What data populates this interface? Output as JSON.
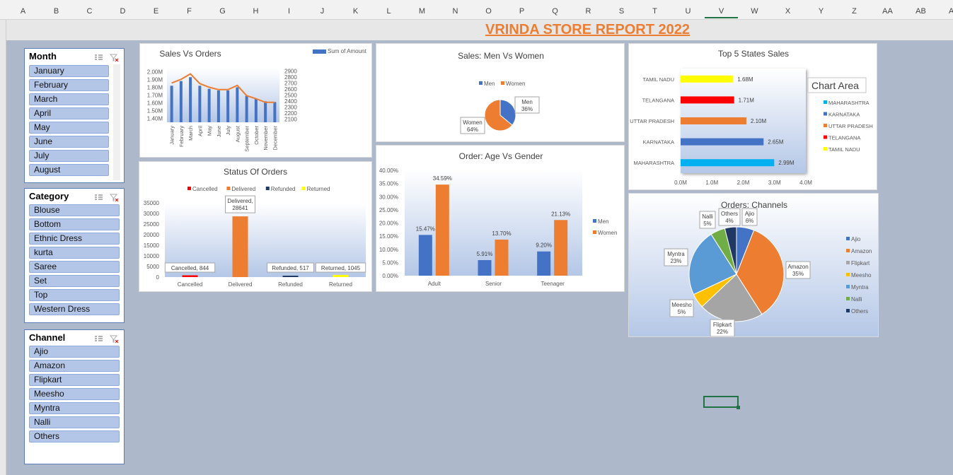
{
  "sheet": {
    "columns": [
      "A",
      "B",
      "C",
      "D",
      "E",
      "F",
      "G",
      "H",
      "I",
      "J",
      "K",
      "L",
      "M",
      "N",
      "O",
      "P",
      "Q",
      "R",
      "S",
      "T",
      "U",
      "V",
      "W",
      "X",
      "Y",
      "Z",
      "AA",
      "AB",
      "AC"
    ],
    "title": "VRINDA STORE REPORT 2022"
  },
  "slicers": {
    "month": {
      "header": "Month",
      "items": [
        "January",
        "February",
        "March",
        "April",
        "May",
        "June",
        "July",
        "August"
      ]
    },
    "category": {
      "header": "Category",
      "items": [
        "Blouse",
        "Bottom",
        "Ethnic Dress",
        "kurta",
        "Saree",
        "Set",
        "Top",
        "Western Dress"
      ]
    },
    "channel": {
      "header": "Channel",
      "items": [
        "Ajio",
        "Amazon",
        "Flipkart",
        "Meesho",
        "Myntra",
        "Nalli",
        "Others"
      ]
    }
  },
  "chart_data": [
    {
      "id": "sales_vs_orders",
      "type": "bar",
      "title": "Sales Vs Orders",
      "legend": [
        "Sum of Amount"
      ],
      "legend_position": "top-right",
      "categories": [
        "January",
        "February",
        "March",
        "April",
        "May",
        "June",
        "July",
        "August",
        "September",
        "October",
        "November",
        "December"
      ],
      "series": [
        {
          "name": "Sum of Amount",
          "type": "bar",
          "axis": "left",
          "values": [
            1.82,
            1.88,
            1.93,
            1.82,
            1.78,
            1.76,
            1.76,
            1.8,
            1.69,
            1.65,
            1.62,
            1.61
          ],
          "color": "#4472c4"
        },
        {
          "type": "line",
          "axis": "right",
          "values": [
            2700,
            2760,
            2850,
            2690,
            2630,
            2590,
            2590,
            2660,
            2490,
            2440,
            2380,
            2380
          ],
          "color": "#ed7d31"
        }
      ],
      "yticks_left": [
        "2.00M",
        "1.90M",
        "1.80M",
        "1.70M",
        "1.60M",
        "1.50M",
        "1.40M"
      ],
      "yleft_range": [
        1.35,
        2.05
      ],
      "yticks_right": [
        "2900",
        "2800",
        "2700",
        "2600",
        "2500",
        "2400",
        "2300",
        "2200",
        "2100"
      ],
      "yright_range": [
        2050,
        2950
      ]
    },
    {
      "id": "status_of_orders",
      "type": "bar",
      "title": "Status Of Orders",
      "legend": [
        "Cancelled",
        "Delivered",
        "Refunded",
        "Returned"
      ],
      "legend_position": "top",
      "categories": [
        "Cancelled",
        "Delivered",
        "Refunded",
        "Returned"
      ],
      "values": [
        844,
        28641,
        517,
        1045
      ],
      "colors": [
        "#ff0000",
        "#ed7d31",
        "#1f3864",
        "#ffff00"
      ],
      "data_labels": [
        "Cancelled, 844",
        "Delivered, 28641",
        "Refunded, 517",
        "Returned, 1045"
      ],
      "yticks": [
        "35000",
        "30000",
        "25000",
        "20000",
        "15000",
        "10000",
        "5000",
        "0"
      ],
      "ylim": [
        0,
        35000
      ]
    },
    {
      "id": "sales_men_vs_women",
      "type": "pie",
      "title": "Sales: Men Vs Women",
      "legend": [
        "Men",
        "Women"
      ],
      "legend_position": "top",
      "labels": [
        "Men",
        "Women"
      ],
      "values": [
        36,
        64
      ],
      "percent_labels": [
        "36%",
        "64%"
      ],
      "colors": [
        "#4472c4",
        "#ed7d31"
      ]
    },
    {
      "id": "order_age_vs_gender",
      "type": "bar",
      "title": "Order: Age Vs Gender",
      "legend": [
        "Men",
        "Women"
      ],
      "legend_position": "right",
      "categories": [
        "Adult",
        "Senior",
        "Teenager"
      ],
      "series": [
        {
          "name": "Men",
          "values": [
            15.47,
            5.91,
            9.2
          ],
          "labels": [
            "15.47%",
            "5.91%",
            "9.20%"
          ],
          "color": "#4472c4"
        },
        {
          "name": "Women",
          "values": [
            34.59,
            13.7,
            21.13
          ],
          "labels": [
            "34.59%",
            "13.70%",
            "21.13%"
          ],
          "color": "#ed7d31"
        }
      ],
      "yticks": [
        "40.00%",
        "35.00%",
        "30.00%",
        "25.00%",
        "20.00%",
        "15.00%",
        "10.00%",
        "5.00%",
        "0.00%"
      ],
      "ylim": [
        0,
        40
      ]
    },
    {
      "id": "top5_states_sales",
      "type": "bar",
      "orientation": "horizontal",
      "title": "Top 5 States Sales",
      "tooltip": "Chart Area",
      "legend": [
        "MAHARASHTRA",
        "KARNATAKA",
        "UTTAR PRADESH",
        "TELANGANA",
        "TAMIL NADU"
      ],
      "legend_position": "right",
      "categories": [
        "TAMIL NADU",
        "TELANGANA",
        "UTTAR PRADESH",
        "KARNATAKA",
        "MAHARASHTRA"
      ],
      "values": [
        1.68,
        1.71,
        2.1,
        2.65,
        2.99
      ],
      "data_labels": [
        "1.68M",
        "1.71M",
        "2.10M",
        "2.65M",
        "2.99M"
      ],
      "colors": [
        "#ffff00",
        "#ff0000",
        "#ed7d31",
        "#4472c4",
        "#00b0f0"
      ],
      "xticks": [
        "0.0M",
        "1.0M",
        "2.0M",
        "3.0M",
        "4.0M"
      ],
      "xlim": [
        0,
        4
      ]
    },
    {
      "id": "orders_channels",
      "type": "pie",
      "title": "Orders: Channels",
      "legend": [
        "Ajio",
        "Amazon",
        "Flipkart",
        "Meesho",
        "Myntra",
        "Nalli",
        "Others"
      ],
      "legend_position": "right",
      "labels": [
        "Ajio",
        "Amazon",
        "Flipkart",
        "Meesho",
        "Myntra",
        "Nalli",
        "Others"
      ],
      "values": [
        6,
        35,
        22,
        5,
        23,
        5,
        4
      ],
      "percent_labels": [
        "6%",
        "35%",
        "22%",
        "5%",
        "23%",
        "5%",
        "4%"
      ],
      "colors": [
        "#4472c4",
        "#ed7d31",
        "#a5a5a5",
        "#ffc000",
        "#5b9bd5",
        "#70ad47",
        "#203864"
      ]
    }
  ]
}
